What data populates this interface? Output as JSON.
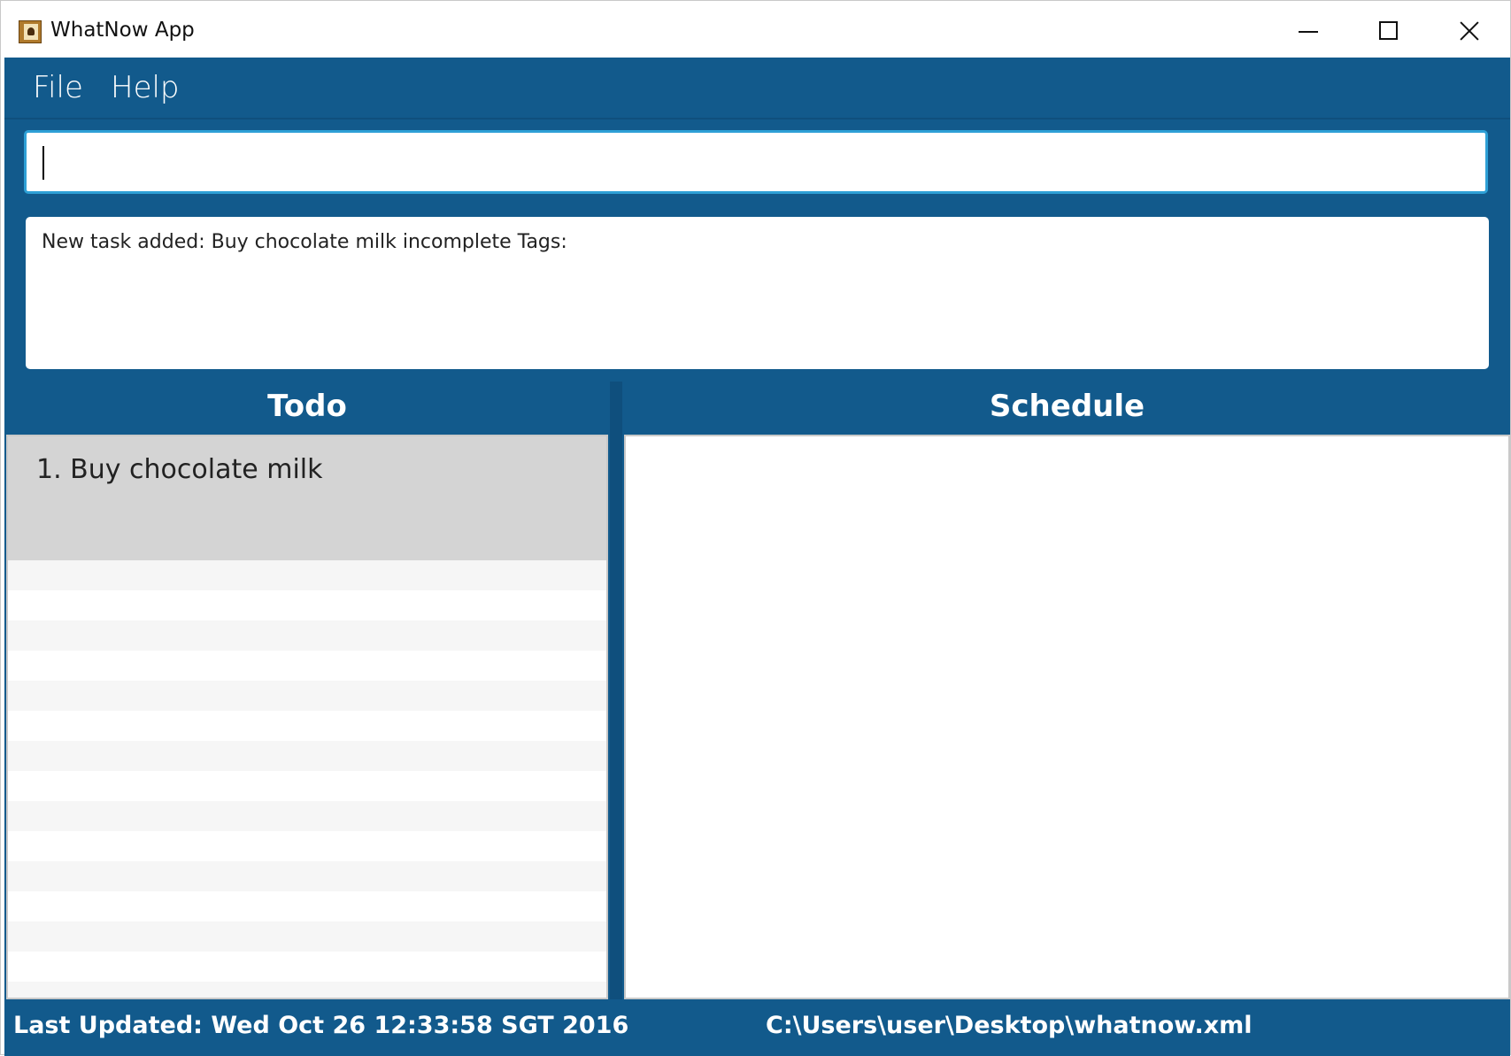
{
  "window": {
    "title": "WhatNow App",
    "icon": "address-book-icon"
  },
  "menu": {
    "items": [
      {
        "label": "File"
      },
      {
        "label": "Help"
      }
    ]
  },
  "command": {
    "value": "",
    "placeholder": ""
  },
  "result": {
    "text": "New task added: Buy chocolate milk incomplete Tags:"
  },
  "panels": {
    "todo": {
      "header": "Todo",
      "items": [
        {
          "text": "1. Buy chocolate milk"
        }
      ]
    },
    "schedule": {
      "header": "Schedule",
      "items": []
    }
  },
  "status": {
    "last_updated": "Last Updated: Wed Oct 26 12:33:58 SGT 2016",
    "file_path": "C:\\Users\\user\\Desktop\\whatnow.xml"
  },
  "colors": {
    "primary": "#125a8c",
    "focus_border": "#2ea0d6",
    "selected_card": "#d4d4d4",
    "stripe": "#f6f6f6"
  }
}
